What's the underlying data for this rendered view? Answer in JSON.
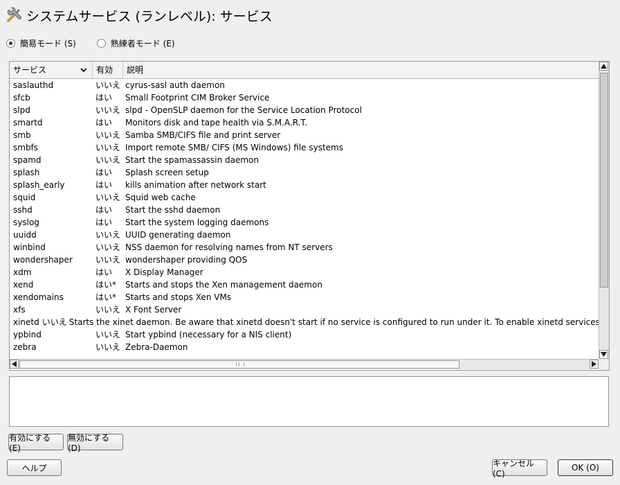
{
  "window": {
    "title": "システムサービス (ランレベル): サービス",
    "icon": "wrench-screwdriver-icon"
  },
  "mode": {
    "simple_label": "簡易モード (S)",
    "expert_label": "熟練者モード (E)",
    "selected": "simple"
  },
  "table": {
    "columns": {
      "service": "サービス",
      "enabled": "有効",
      "description": "説明"
    },
    "rows": [
      {
        "service": "saslauthd",
        "enabled": "いいえ",
        "description": "cyrus-sasl auth daemon"
      },
      {
        "service": "sfcb",
        "enabled": "はい",
        "description": "Small Footprint CIM Broker Service"
      },
      {
        "service": "slpd",
        "enabled": "いいえ",
        "description": "slpd - OpenSLP daemon for the Service Location Protocol"
      },
      {
        "service": "smartd",
        "enabled": "はい",
        "description": "Monitors disk and tape health via S.M.A.R.T."
      },
      {
        "service": "smb",
        "enabled": "いいえ",
        "description": "Samba SMB/CIFS file and print server"
      },
      {
        "service": "smbfs",
        "enabled": "いいえ",
        "description": "Import remote SMB/ CIFS (MS Windows) file systems"
      },
      {
        "service": "spamd",
        "enabled": "いいえ",
        "description": "Start the spamassassin daemon"
      },
      {
        "service": "splash",
        "enabled": "はい",
        "description": "Splash screen setup"
      },
      {
        "service": "splash_early",
        "enabled": "はい",
        "description": "kills animation after network start"
      },
      {
        "service": "squid",
        "enabled": "いいえ",
        "description": "Squid web cache"
      },
      {
        "service": "sshd",
        "enabled": "はい",
        "description": "Start the sshd daemon"
      },
      {
        "service": "syslog",
        "enabled": "はい",
        "description": "Start the system logging daemons"
      },
      {
        "service": "uuidd",
        "enabled": "いいえ",
        "description": "UUID generating daemon"
      },
      {
        "service": "winbind",
        "enabled": "いいえ",
        "description": "NSS daemon for resolving names from NT servers"
      },
      {
        "service": "wondershaper",
        "enabled": "いいえ",
        "description": "wondershaper providing QOS"
      },
      {
        "service": "xdm",
        "enabled": "はい",
        "description": "X Display Manager"
      },
      {
        "service": "xend",
        "enabled": "はい*",
        "description": "Starts and stops the Xen management daemon"
      },
      {
        "service": "xendomains",
        "enabled": "はい*",
        "description": "Starts and stops Xen VMs"
      },
      {
        "service": "xfs",
        "enabled": "いいえ",
        "description": "X Font Server"
      },
      {
        "service": "xinetd",
        "enabled": "いいえ",
        "description": "Starts the xinet daemon. Be aware that xinetd doesn't start if no service is configured to run under it. To enable xinetd services g"
      },
      {
        "service": "ypbind",
        "enabled": "いいえ",
        "description": "Start ypbind (necessary for a NIS client)"
      },
      {
        "service": "zebra",
        "enabled": "いいえ",
        "description": "Zebra-Daemon"
      }
    ]
  },
  "buttons": {
    "enable": "有効にする (E)",
    "disable": "無効にする (D)",
    "help": "ヘルプ",
    "cancel": "キャンセル (C)",
    "ok": "OK (O)"
  }
}
